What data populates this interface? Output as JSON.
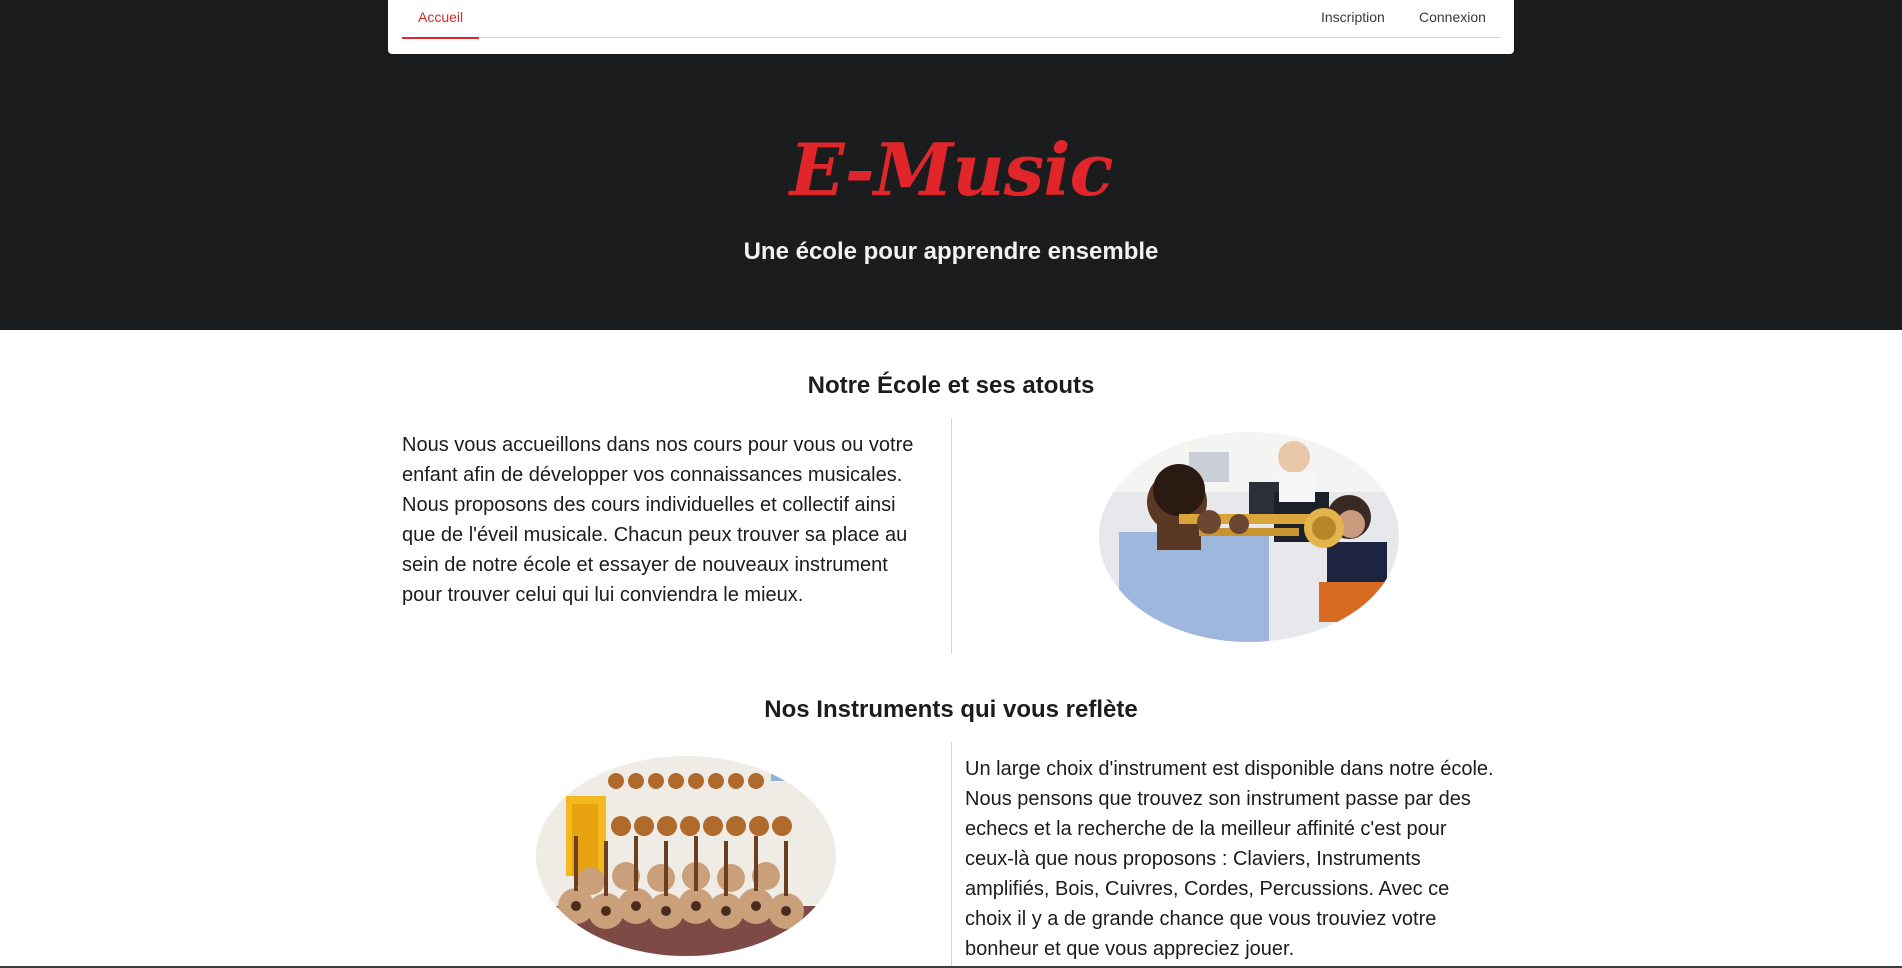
{
  "nav": {
    "home": "Accueil",
    "signup": "Inscription",
    "login": "Connexion"
  },
  "hero": {
    "brand": "E-Music",
    "tagline": "Une école pour apprendre ensemble"
  },
  "sections": [
    {
      "title": "Notre École et ses atouts",
      "text": "Nous vous accueillons dans nos cours pour vous ou votre enfant afin de développer vos connaissances musicales. Nous proposons des cours individuelles et collectif ainsi que de l'éveil musicale. Chacun peux trouver sa place au sein de notre école et essayer de nouveaux instrument pour trouver celui qui lui conviendra le mieux."
    },
    {
      "title": "Nos Instruments qui vous reflète",
      "text": "Un large choix d'instrument est disponible dans notre école. Nous pensons que trouvez son instrument passe par des echecs et la recherche de la meilleur affinité c'est pour ceux-là que nous proposons : Claviers, Instruments amplifiés, Bois, Cuivres, Cordes, Percussions. Avec ce choix il y a de grande chance que vous trouviez votre bonheur et que vous appreciez jouer."
    }
  ],
  "colors": {
    "accent": "#db2828",
    "hero_bg": "#1b1c1d"
  }
}
